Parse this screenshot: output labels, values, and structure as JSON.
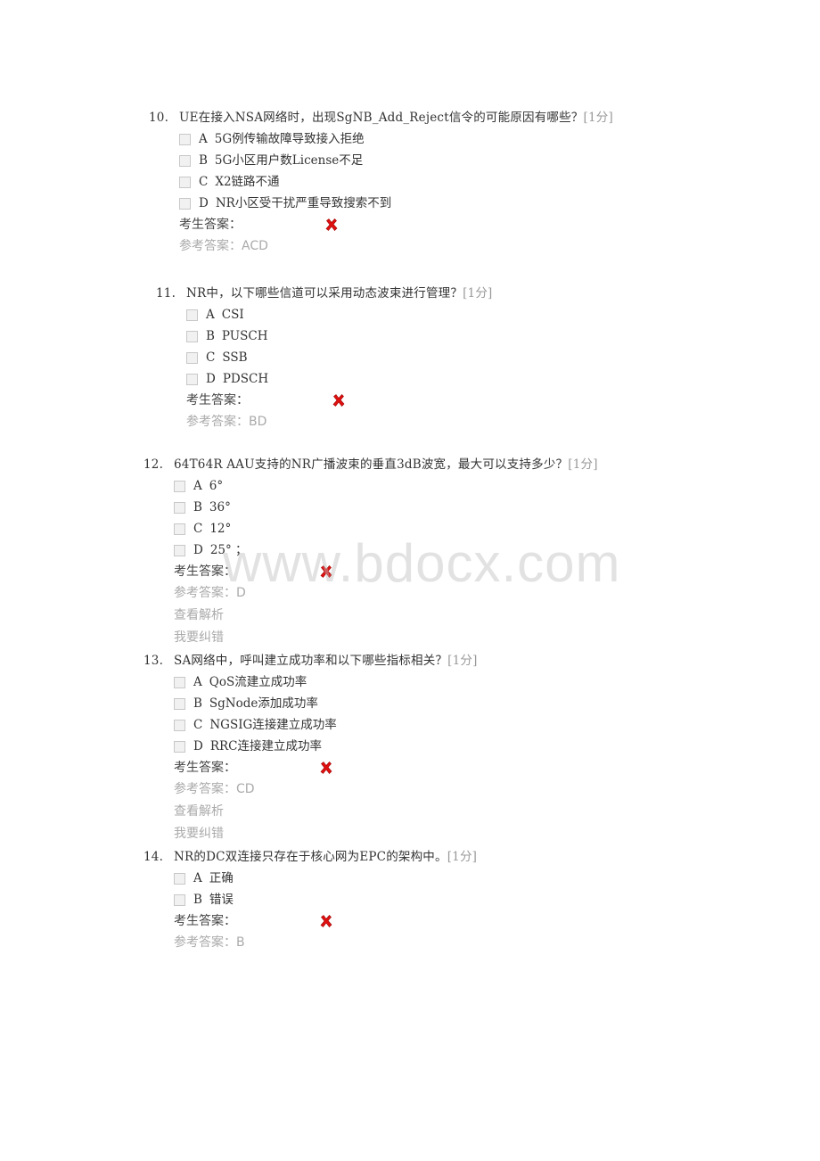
{
  "questions": [
    {
      "number": "10.",
      "text": "UE在接入NSA网络时，出现SgNB_Add_Reject信令的可能原因有哪些？",
      "score": "[1分]",
      "options": [
        {
          "letter": "A",
          "text": "5G例传输故障导致接入拒绝"
        },
        {
          "letter": "B",
          "text": "5G小区用户数License不足"
        },
        {
          "letter": "C",
          "text": "X2链路不通"
        },
        {
          "letter": "D",
          "text": "NR小区受干扰严重导致搜索不到"
        }
      ],
      "student_answer_label": "考生答案：",
      "result_icon": "red-x-icon",
      "reference_answer": "参考答案：ACD"
    },
    {
      "number": "11.",
      "text": "NR中，以下哪些信道可以采用动态波束进行管理？",
      "score": "[1分]",
      "options": [
        {
          "letter": "A",
          "text": "CSI"
        },
        {
          "letter": "B",
          "text": "PUSCH"
        },
        {
          "letter": "C",
          "text": "SSB"
        },
        {
          "letter": "D",
          "text": "PDSCH"
        }
      ],
      "student_answer_label": "考生答案：",
      "result_icon": "red-x-icon",
      "reference_answer": "参考答案：BD"
    },
    {
      "number": "12.",
      "text": "64T64R AAU支持的NR广播波束的垂直3dB波宽，最大可以支持多少？",
      "score": "[1分]",
      "options": [
        {
          "letter": "A",
          "text": "6°"
        },
        {
          "letter": "B",
          "text": "36°"
        },
        {
          "letter": "C",
          "text": "12°"
        },
        {
          "letter": "D",
          "text": "25° ；"
        }
      ],
      "student_answer_label": "考生答案：",
      "result_icon": "red-x-icon",
      "reference_answer": "参考答案：D",
      "view_analysis": "查看解析",
      "report_error": "我要纠错"
    },
    {
      "number": "13.",
      "text": "SA网络中，呼叫建立成功率和以下哪些指标相关？",
      "score": "[1分]",
      "options": [
        {
          "letter": "A",
          "text": "QoS流建立成功率"
        },
        {
          "letter": "B",
          "text": "SgNode添加成功率"
        },
        {
          "letter": "C",
          "text": "NGSIG连接建立成功率"
        },
        {
          "letter": "D",
          "text": "RRC连接建立成功率"
        }
      ],
      "student_answer_label": "考生答案：",
      "result_icon": "red-x-icon",
      "reference_answer": "参考答案：CD",
      "view_analysis": "查看解析",
      "report_error": "我要纠错"
    },
    {
      "number": "14.",
      "text": "NR的DC双连接只存在于核心网为EPC的架构中。",
      "score": "[1分]",
      "options": [
        {
          "letter": "A",
          "text": "正确"
        },
        {
          "letter": "B",
          "text": "错误"
        }
      ],
      "student_answer_label": "考生答案：",
      "result_icon": "red-x-icon",
      "reference_answer": "参考答案：B"
    }
  ],
  "watermark": "www.bdocx.com",
  "colors": {
    "wrong_mark": "#e01010",
    "muted_text": "#aaaaaa",
    "body_text": "#333333"
  }
}
